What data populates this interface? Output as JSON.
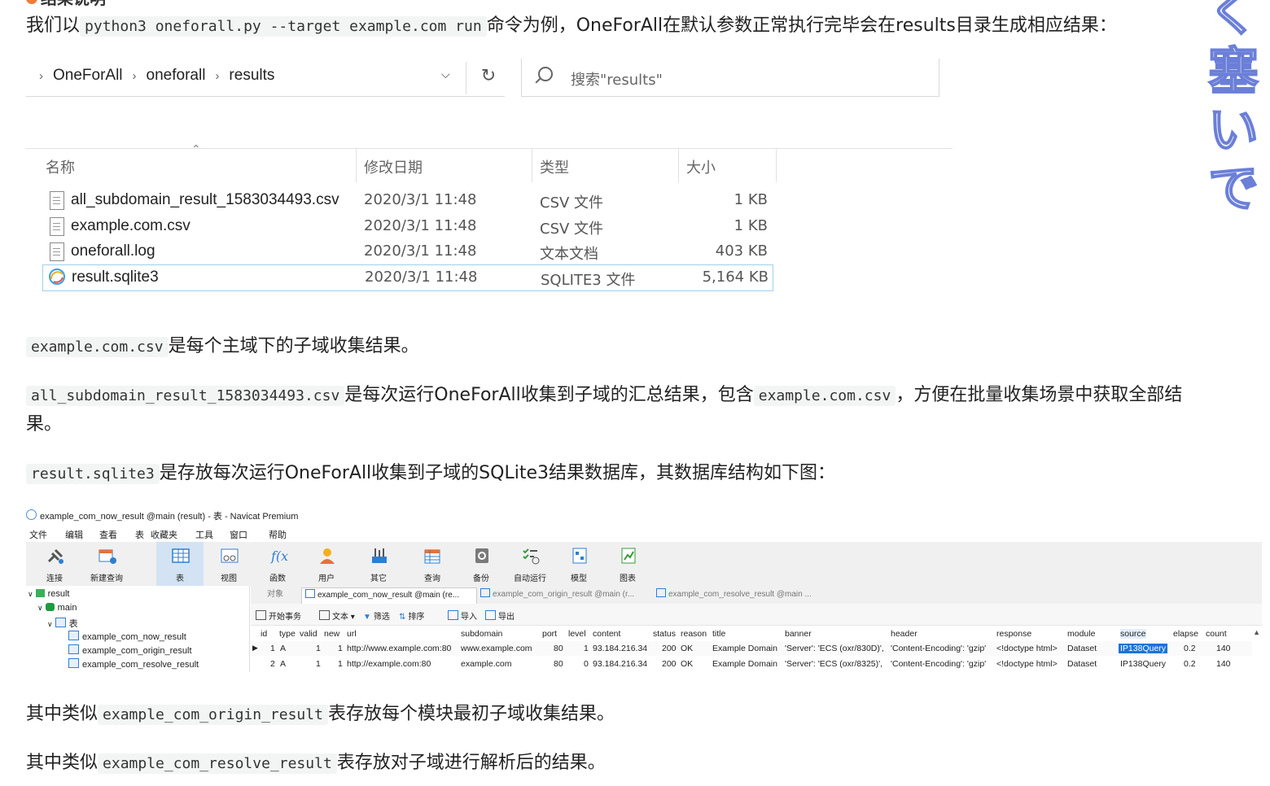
{
  "top_cut_heading": "结果说明",
  "intro": {
    "prefix": "我们以",
    "code": "python3 oneforall.py --target example.com run",
    "suffix": "命令为例，OneForAll在默认参数正常执行完毕会在results目录生成相应结果："
  },
  "explorer": {
    "breadcrumb": [
      "OneForAll",
      "oneforall",
      "results"
    ],
    "search_placeholder": "搜索\"results\"",
    "columns": {
      "name": "名称",
      "date": "修改日期",
      "type": "类型",
      "size": "大小"
    },
    "files": [
      {
        "name": "all_subdomain_result_1583034493.csv",
        "date": "2020/3/1 11:48",
        "type": "CSV 文件",
        "size": "1 KB"
      },
      {
        "name": "example.com.csv",
        "date": "2020/3/1 11:48",
        "type": "CSV 文件",
        "size": "1 KB"
      },
      {
        "name": "oneforall.log",
        "date": "2020/3/1 11:48",
        "type": "文本文档",
        "size": "403 KB"
      },
      {
        "name": "result.sqlite3",
        "date": "2020/3/1 11:48",
        "type": "SQLITE3 文件",
        "size": "5,164 KB"
      }
    ]
  },
  "p1": {
    "code": "example.com.csv",
    "text": "是每个主域下的子域收集结果。"
  },
  "p2": {
    "code1": "all_subdomain_result_1583034493.csv",
    "text1": "是每次运行OneForAll收集到子域的汇总结果，包含",
    "code2": "example.com.csv",
    "text2": "，方便在批量收集场景中获取全部结",
    "text3": "果。"
  },
  "p3": {
    "code": "result.sqlite3",
    "text": "是存放每次运行OneForAll收集到子域的SQLite3结果数据库，其数据库结构如下图："
  },
  "navicat": {
    "window_title": "example_com_now_result @main (result) - 表 - Navicat Premium",
    "menu": [
      "文件",
      "编辑",
      "查看",
      "表",
      "收藏夹",
      "工具",
      "窗口",
      "帮助"
    ],
    "toolbar": [
      "连接",
      "新建查询",
      "表",
      "视图",
      "函数",
      "用户",
      "其它",
      "查询",
      "备份",
      "自动运行",
      "模型",
      "图表"
    ],
    "tree": {
      "conn": "result",
      "db": "main",
      "group": "表",
      "tables": [
        "example_com_now_result",
        "example_com_origin_result",
        "example_com_resolve_result"
      ]
    },
    "tabs": [
      "对象",
      "example_com_now_result @main (re...",
      "example_com_origin_result @main (r...",
      "example_com_resolve_result @main ..."
    ],
    "subtoolbar": [
      "开始事务",
      "文本",
      "筛选",
      "排序",
      "导入",
      "导出"
    ],
    "columns": [
      "id",
      "type",
      "valid",
      "new",
      "url",
      "subdomain",
      "port",
      "level",
      "content",
      "status",
      "reason",
      "title",
      "banner",
      "header",
      "response",
      "module",
      "source",
      "elapse",
      "count"
    ],
    "rows": [
      [
        "1",
        "A",
        "1",
        "1",
        "http://www.example.com:80",
        "www.example.com",
        "80",
        "1",
        "93.184.216.34",
        "200",
        "OK",
        "Example Domain",
        "'Server': 'ECS (oxr/830D)',",
        "'Content-Encoding': 'gzip'",
        "<!doctype html>",
        "Dataset",
        "IP138Query",
        "0.2",
        "140"
      ],
      [
        "2",
        "A",
        "1",
        "1",
        "http://example.com:80",
        "example.com",
        "80",
        "0",
        "93.184.216.34",
        "200",
        "OK",
        "Example Domain",
        "'Server': 'ECS (oxr/8325)',",
        "'Content-Encoding': 'gzip'",
        "<!doctype html>",
        "Dataset",
        "IP138Query",
        "0.2",
        "140"
      ]
    ]
  },
  "p4": {
    "prefix": "其中类似",
    "code": "example_com_origin_result",
    "text": "表存放每个模块最初子域收集结果。"
  },
  "p5": {
    "prefix": "其中类似",
    "code": "example_com_resolve_result",
    "text": "表存放对子域进行解析后的结果。"
  },
  "deco_chars": [
    "く",
    "塞",
    "い",
    "で"
  ],
  "colors": {
    "accent": "#1a73d9",
    "selection_border": "#9fd0f0",
    "code_bg": "#f3f4f4",
    "deco_stroke": "#6b7fd8"
  }
}
